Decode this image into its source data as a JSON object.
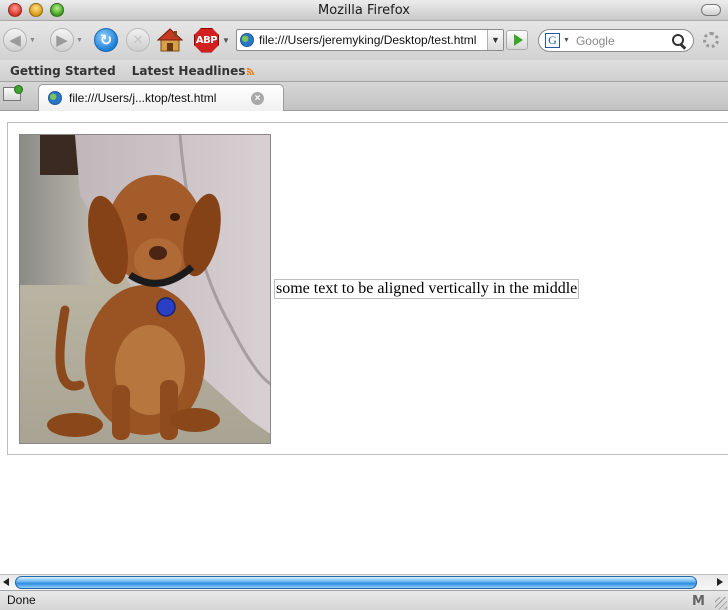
{
  "window": {
    "title": "Mozilla Firefox"
  },
  "navigation": {
    "back": "back-arrow-icon",
    "forward": "forward-arrow-icon",
    "reload": "reload-icon",
    "stop": "stop-icon",
    "home": "home-icon",
    "adblock_label": "ABP",
    "url": "file:///Users/jeremyking/Desktop/test.html",
    "search_engine_letter": "G",
    "search_placeholder": "Google"
  },
  "bookmarks": {
    "items": [
      {
        "label": "Getting Started"
      },
      {
        "label": "Latest Headlines",
        "icon": "rss-feed-icon"
      }
    ]
  },
  "tabs": [
    {
      "label": "file:///Users/j...ktop/test.html",
      "active": true
    }
  ],
  "page": {
    "image_description_icon": "dog-photo",
    "caption": "some text to be aligned vertically in the middle"
  },
  "scrollbar": {
    "horizontal_thumb_fraction": 0.96
  },
  "status": {
    "text": "Done",
    "icon_label": "M"
  },
  "colors": {
    "accent": "#2d8de0",
    "go_arrow": "#3da52c",
    "adblock": "#d21f1f"
  }
}
